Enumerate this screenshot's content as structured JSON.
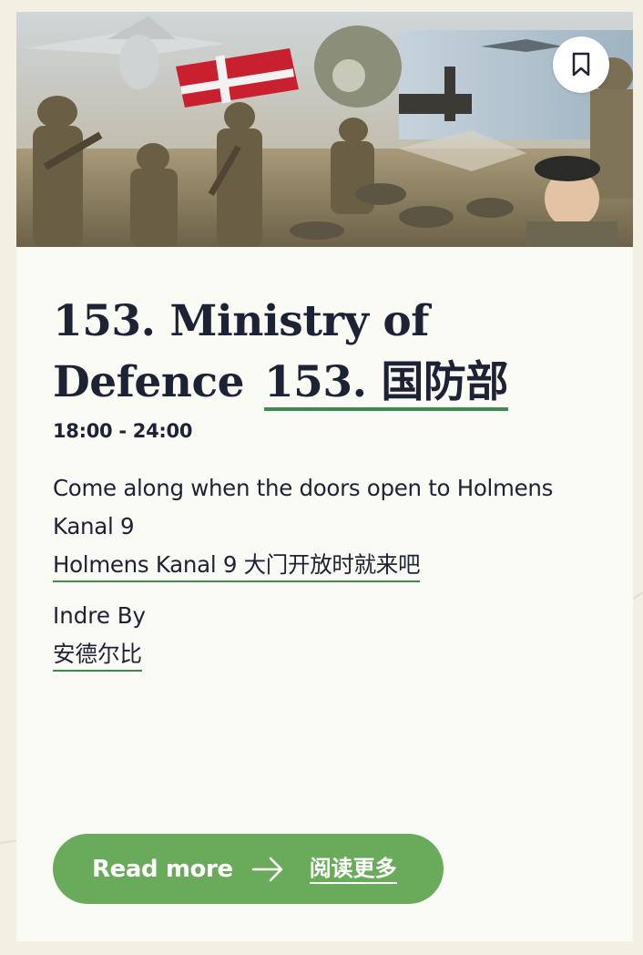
{
  "event": {
    "title_en": "153. Ministry of Defence",
    "title_zh": "153. 国防部",
    "time": "18:00 - 24:00",
    "description_en": "Come along when the doors open to Holmens Kanal 9",
    "description_zh": "Holmens Kanal 9 大门开放时就来吧",
    "area_en": "Indre By",
    "area_zh": "安德尔比"
  },
  "actions": {
    "bookmark_icon": "bookmark-icon",
    "read_more_label": "Read more",
    "read_more_zh": "阅读更多",
    "arrow_icon": "arrow-right-icon"
  },
  "colors": {
    "page_bg": "#f3efe3",
    "card_bg": "#fbfbf6",
    "text": "#1e2235",
    "accent_green": "#6aab5b",
    "underline_green": "#3f8a4f"
  }
}
